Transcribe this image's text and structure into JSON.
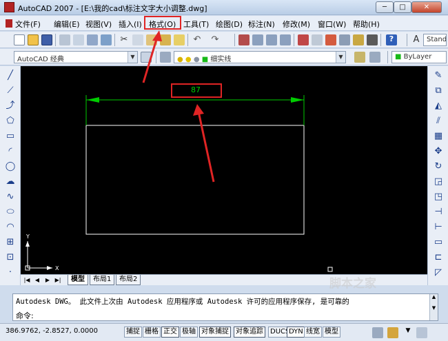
{
  "window": {
    "title": "AutoCAD 2007 - [E:\\我的cad\\标注文字大小调整.dwg]",
    "min_glyph": "─",
    "max_glyph": "□",
    "close_glyph": "✕"
  },
  "menu": {
    "items": [
      "文件(F)",
      "编辑(E)",
      "视图(V)",
      "插入(I)",
      "格式(O)",
      "工具(T)",
      "绘图(D)",
      "标注(N)",
      "修改(M)",
      "窗口(W)",
      "帮助(H)"
    ],
    "highlighted": "格式(O)",
    "mdi_buttons": [
      "_",
      "▫",
      "x"
    ]
  },
  "toolbar1": {
    "text_style_combo": "Stand"
  },
  "toolbar2": {
    "workspace": "AutoCAD 经典",
    "layer": "细实线",
    "color": "ByLayer"
  },
  "drawing": {
    "dimension_text": "87",
    "background": "#000000",
    "dim_color": "#00cc00",
    "annotation_color": "#e02424",
    "ucs_x": "X",
    "ucs_y": "Y"
  },
  "tabs": {
    "items": [
      "模型",
      "布局1",
      "布局2"
    ],
    "active": "模型"
  },
  "command": {
    "line1": "Autodesk DWG。  此文件上次由 Autodesk 应用程序或 Autodesk 许可的应用程序保存, 是可靠的",
    "prompt": "命令:"
  },
  "status": {
    "coords": "386.9762, -2.8527, 0.0000",
    "buttons": [
      "捕捉",
      "栅格",
      "正交",
      "极轴",
      "对象捕捉",
      "对象追踪",
      "DUCS",
      "DYN",
      "线宽",
      "模型"
    ]
  },
  "watermark": "脚本之家"
}
